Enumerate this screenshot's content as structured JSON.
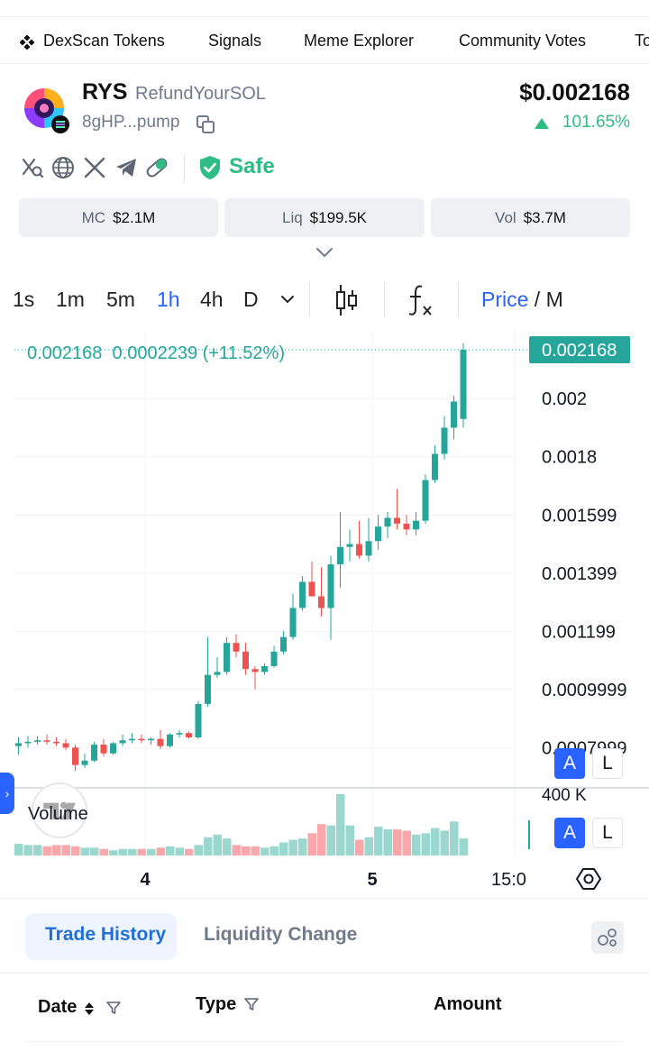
{
  "nav": {
    "items": [
      "DexScan Tokens",
      "Signals",
      "Meme Explorer",
      "Community Votes",
      "To"
    ]
  },
  "token": {
    "symbol": "RYS",
    "name": "RefundYourSOL",
    "address": "8gHP...pump",
    "price": "$0.002168",
    "change": "101.65%",
    "safe_label": "Safe"
  },
  "stats": [
    {
      "label": "MC",
      "value": "$2.1M"
    },
    {
      "label": "Liq",
      "value": "$199.5K"
    },
    {
      "label": "Vol",
      "value": "$3.7M"
    }
  ],
  "timeframes": [
    "1s",
    "1m",
    "5m",
    "1h",
    "4h",
    "D"
  ],
  "active_timeframe": "1h",
  "chart_toolbar": {
    "price_label": "Price",
    "sep": " / ",
    "mcap_label": "M"
  },
  "chart_data": {
    "type": "candlestick",
    "legend_close": "0.002168",
    "legend_change": "0.0002239 (+11.52%)",
    "last_price_label": "0.002168",
    "y_tick_labels": [
      "0.002",
      "0.0018",
      "0.001599",
      "0.001399",
      "0.001199",
      "0.0009999",
      "0.0007999"
    ],
    "ylim": [
      0.00068,
      0.00223
    ],
    "x_tick_labels": [
      "4",
      "5",
      "15:0"
    ],
    "volume_label": "Volume",
    "volume_scale_label": "400 K",
    "scale_buttons": [
      "A",
      "L"
    ],
    "candles": [
      {
        "o": 0.000805,
        "h": 0.000835,
        "l": 0.000775,
        "c": 0.000815
      },
      {
        "o": 0.000815,
        "h": 0.00084,
        "l": 0.0008,
        "c": 0.00082
      },
      {
        "o": 0.00082,
        "h": 0.00084,
        "l": 0.00081,
        "c": 0.000825
      },
      {
        "o": 0.000825,
        "h": 0.000845,
        "l": 0.00081,
        "c": 0.00082
      },
      {
        "o": 0.00082,
        "h": 0.000835,
        "l": 0.000805,
        "c": 0.000815
      },
      {
        "o": 0.000815,
        "h": 0.00083,
        "l": 0.00079,
        "c": 0.0008
      },
      {
        "o": 0.0008,
        "h": 0.00081,
        "l": 0.00072,
        "c": 0.00074
      },
      {
        "o": 0.00074,
        "h": 0.00078,
        "l": 0.00073,
        "c": 0.000755
      },
      {
        "o": 0.000755,
        "h": 0.00082,
        "l": 0.00075,
        "c": 0.00081
      },
      {
        "o": 0.00081,
        "h": 0.00083,
        "l": 0.00077,
        "c": 0.00078
      },
      {
        "o": 0.00078,
        "h": 0.00082,
        "l": 0.000775,
        "c": 0.000815
      },
      {
        "o": 0.000815,
        "h": 0.000845,
        "l": 0.000805,
        "c": 0.000825
      },
      {
        "o": 0.000825,
        "h": 0.00085,
        "l": 0.000815,
        "c": 0.00083
      },
      {
        "o": 0.00083,
        "h": 0.000845,
        "l": 0.000815,
        "c": 0.000825
      },
      {
        "o": 0.000825,
        "h": 0.000835,
        "l": 0.00081,
        "c": 0.00083
      },
      {
        "o": 0.00083,
        "h": 0.00086,
        "l": 0.000795,
        "c": 0.000805
      },
      {
        "o": 0.000805,
        "h": 0.00085,
        "l": 0.0008,
        "c": 0.000845
      },
      {
        "o": 0.000845,
        "h": 0.00086,
        "l": 0.000835,
        "c": 0.00085
      },
      {
        "o": 0.00085,
        "h": 0.000855,
        "l": 0.00083,
        "c": 0.000835
      },
      {
        "o": 0.000835,
        "h": 0.00096,
        "l": 0.00083,
        "c": 0.00095
      },
      {
        "o": 0.00095,
        "h": 0.00118,
        "l": 0.00094,
        "c": 0.00105
      },
      {
        "o": 0.00105,
        "h": 0.00111,
        "l": 0.00104,
        "c": 0.00106
      },
      {
        "o": 0.00106,
        "h": 0.00118,
        "l": 0.00105,
        "c": 0.00116
      },
      {
        "o": 0.00116,
        "h": 0.00119,
        "l": 0.00111,
        "c": 0.00113
      },
      {
        "o": 0.00113,
        "h": 0.00116,
        "l": 0.00105,
        "c": 0.00107
      },
      {
        "o": 0.00107,
        "h": 0.00108,
        "l": 0.001,
        "c": 0.00106
      },
      {
        "o": 0.00106,
        "h": 0.00109,
        "l": 0.00105,
        "c": 0.00108
      },
      {
        "o": 0.00108,
        "h": 0.00115,
        "l": 0.001075,
        "c": 0.00113
      },
      {
        "o": 0.00113,
        "h": 0.0012,
        "l": 0.00112,
        "c": 0.00118
      },
      {
        "o": 0.00118,
        "h": 0.00133,
        "l": 0.00117,
        "c": 0.00128
      },
      {
        "o": 0.00128,
        "h": 0.00139,
        "l": 0.00127,
        "c": 0.00137
      },
      {
        "o": 0.00137,
        "h": 0.00144,
        "l": 0.00133,
        "c": 0.00132
      },
      {
        "o": 0.00132,
        "h": 0.00142,
        "l": 0.00125,
        "c": 0.00128
      },
      {
        "o": 0.00128,
        "h": 0.00146,
        "l": 0.00117,
        "c": 0.00143
      },
      {
        "o": 0.00143,
        "h": 0.00161,
        "l": 0.00135,
        "c": 0.00149
      },
      {
        "o": 0.00149,
        "h": 0.00155,
        "l": 0.00144,
        "c": 0.0015
      },
      {
        "o": 0.0015,
        "h": 0.00158,
        "l": 0.00145,
        "c": 0.00146
      },
      {
        "o": 0.00146,
        "h": 0.00159,
        "l": 0.00144,
        "c": 0.00151
      },
      {
        "o": 0.00151,
        "h": 0.0016,
        "l": 0.00148,
        "c": 0.00156
      },
      {
        "o": 0.00156,
        "h": 0.00161,
        "l": 0.00152,
        "c": 0.00159
      },
      {
        "o": 0.00159,
        "h": 0.00169,
        "l": 0.00155,
        "c": 0.00157
      },
      {
        "o": 0.00157,
        "h": 0.0016,
        "l": 0.00153,
        "c": 0.00155
      },
      {
        "o": 0.00155,
        "h": 0.00161,
        "l": 0.00153,
        "c": 0.00158
      },
      {
        "o": 0.00158,
        "h": 0.00174,
        "l": 0.00157,
        "c": 0.00172
      },
      {
        "o": 0.00172,
        "h": 0.00184,
        "l": 0.00171,
        "c": 0.00181
      },
      {
        "o": 0.00181,
        "h": 0.00194,
        "l": 0.00179,
        "c": 0.0019
      },
      {
        "o": 0.0019,
        "h": 0.00201,
        "l": 0.00186,
        "c": 0.00199
      },
      {
        "o": 0.00193,
        "h": 0.00219,
        "l": 0.0019,
        "c": 0.002168
      }
    ],
    "volumes": [
      0.09,
      0.08,
      0.08,
      0.07,
      0.08,
      0.08,
      0.07,
      0.06,
      0.06,
      0.05,
      0.04,
      0.05,
      0.05,
      0.05,
      0.05,
      0.06,
      0.07,
      0.06,
      0.05,
      0.08,
      0.14,
      0.16,
      0.13,
      0.08,
      0.07,
      0.07,
      0.06,
      0.07,
      0.1,
      0.12,
      0.13,
      0.17,
      0.24,
      0.23,
      0.47,
      0.23,
      0.12,
      0.14,
      0.22,
      0.2,
      0.2,
      0.19,
      0.16,
      0.17,
      0.21,
      0.19,
      0.26,
      0.13
    ]
  },
  "colors": {
    "up": "#26a69a",
    "down": "#ef5350",
    "accent": "#2962ff",
    "positive": "#2ebd85"
  },
  "tabs": {
    "trade_history": "Trade History",
    "liquidity_change": "Liquidity Change"
  },
  "table_headers": {
    "date": "Date",
    "type": "Type",
    "amount": "Amount"
  }
}
